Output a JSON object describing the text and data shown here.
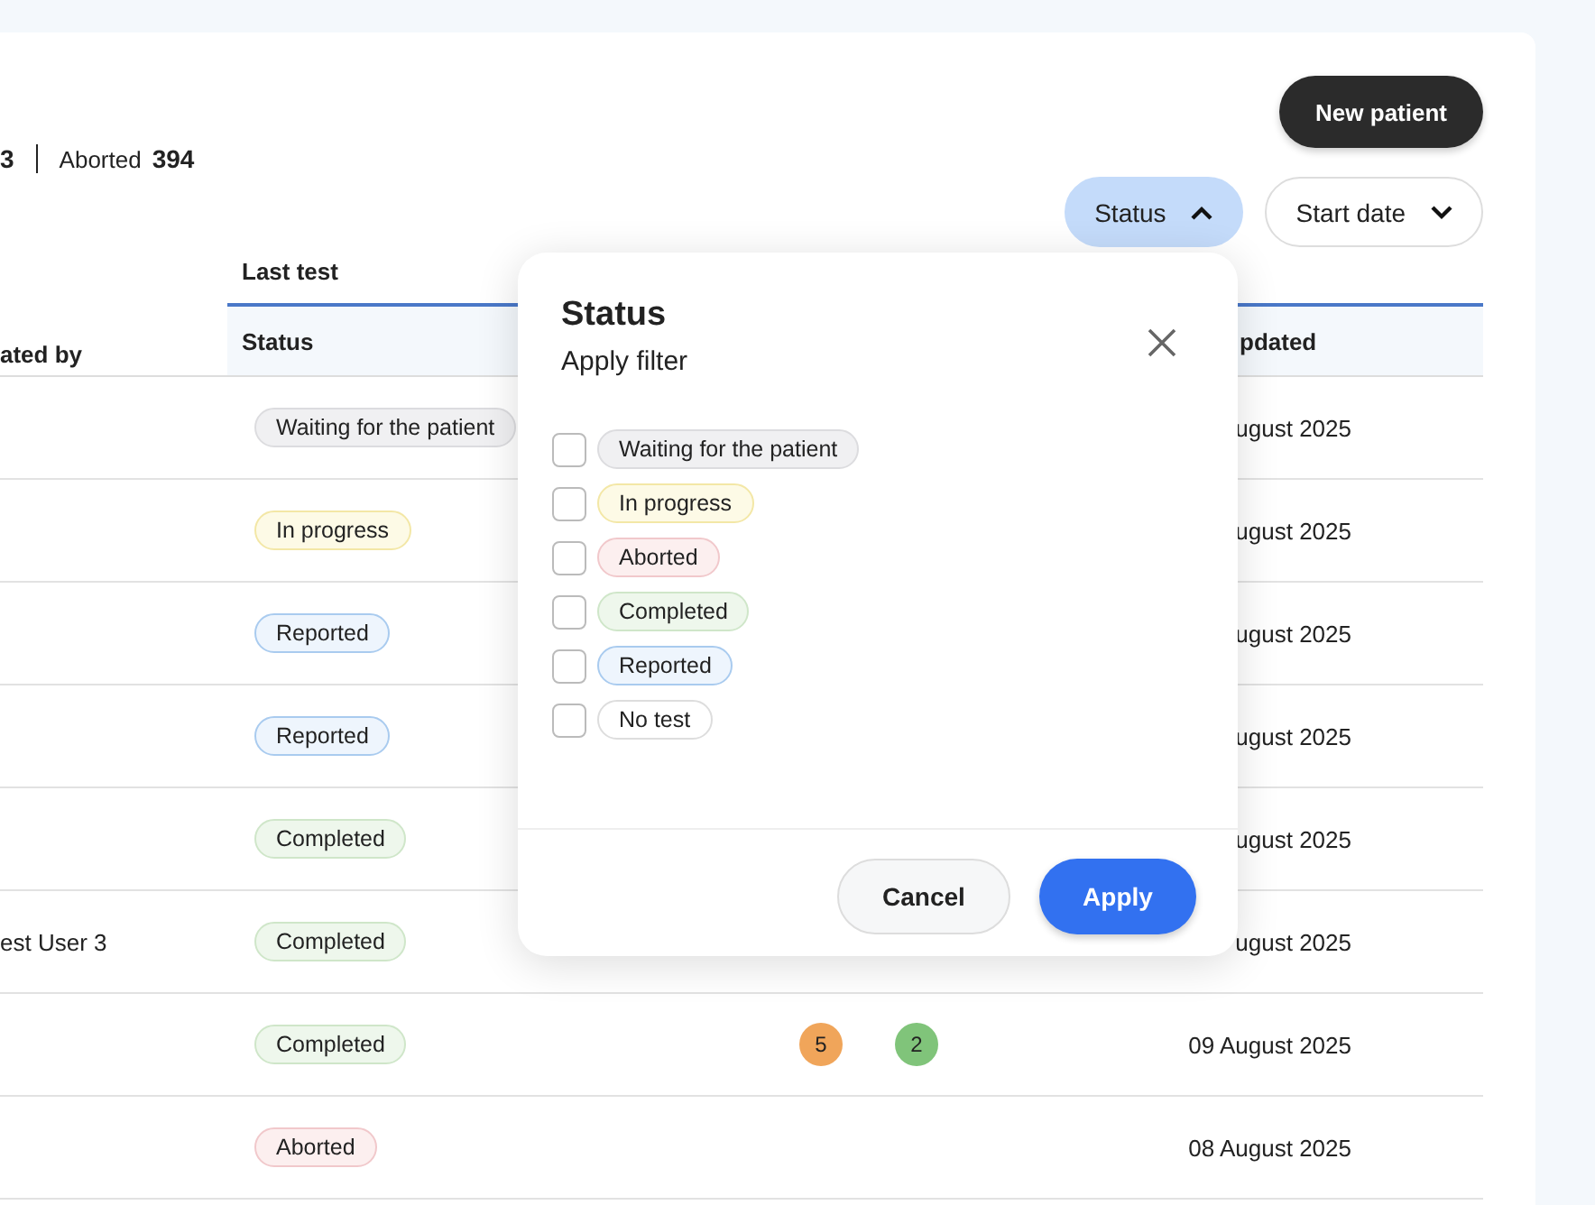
{
  "stats": [
    {
      "value": "3"
    },
    {
      "label": "Aborted",
      "value": "394"
    }
  ],
  "new_patient_button": "New patient",
  "filters": [
    {
      "label": "Status",
      "expanded": true
    },
    {
      "label": "Start date",
      "expanded": false
    }
  ],
  "table": {
    "group_header": "Last test",
    "columns": [
      "ated by",
      "Status",
      "pdated"
    ],
    "rows": [
      {
        "status": {
          "label": "Waiting for the patient",
          "kind": "waiting"
        },
        "updated": "ugust 2025"
      },
      {
        "status": {
          "label": "In progress",
          "kind": "progress"
        },
        "updated": "ugust 2025"
      },
      {
        "status": {
          "label": "Reported",
          "kind": "reported"
        },
        "updated": "ugust 2025"
      },
      {
        "status": {
          "label": "Reported",
          "kind": "reported"
        },
        "updated": "ugust 2025"
      },
      {
        "status": {
          "label": "Completed",
          "kind": "completed"
        },
        "updated": "ugust 2025"
      },
      {
        "created_by": "est User 3",
        "status": {
          "label": "Completed",
          "kind": "completed"
        },
        "updated": "ugust 2025"
      },
      {
        "status": {
          "label": "Completed",
          "kind": "completed"
        },
        "counts": [
          {
            "value": "5",
            "color": "#f0a55a"
          },
          {
            "value": "2",
            "color": "#80c47a"
          }
        ],
        "updated": "09 August 2025"
      },
      {
        "status": {
          "label": "Aborted",
          "kind": "aborted"
        },
        "updated": "08 August 2025"
      }
    ]
  },
  "popup": {
    "title": "Status",
    "subtitle": "Apply filter",
    "options": [
      {
        "label": "Waiting for the patient",
        "kind": "waiting",
        "checked": false
      },
      {
        "label": "In progress",
        "kind": "progress",
        "checked": false
      },
      {
        "label": "Aborted",
        "kind": "aborted",
        "checked": false
      },
      {
        "label": "Completed",
        "kind": "completed",
        "checked": false
      },
      {
        "label": "Reported",
        "kind": "reported",
        "checked": false
      },
      {
        "label": "No test",
        "kind": "notest",
        "checked": false
      }
    ],
    "buttons": [
      "Cancel",
      "Apply"
    ]
  }
}
